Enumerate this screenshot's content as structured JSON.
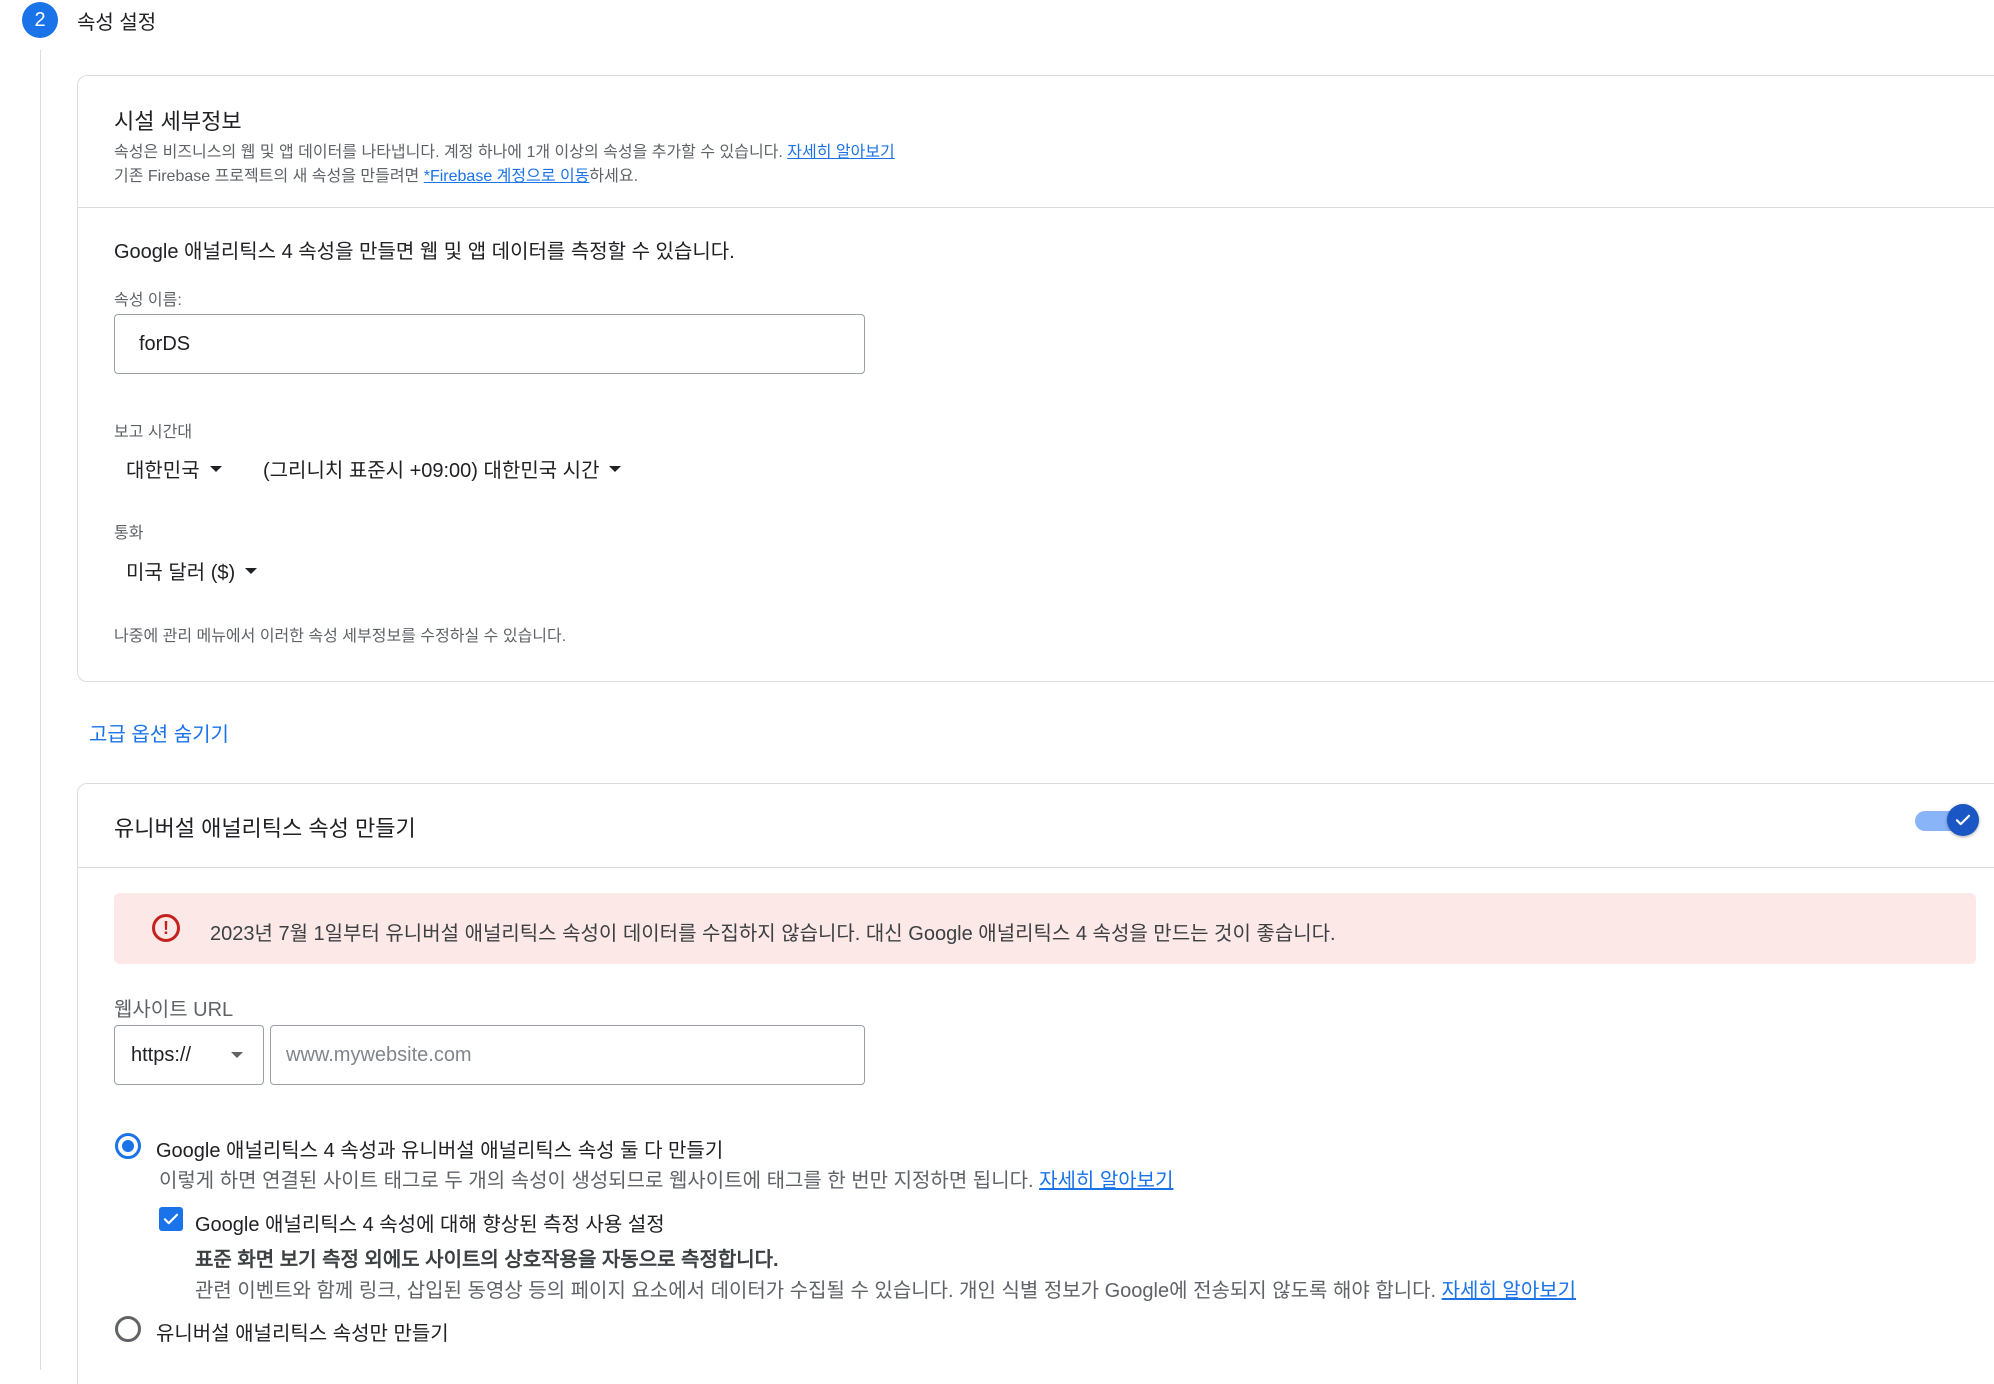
{
  "step": {
    "number": "2",
    "title": "속성 설정"
  },
  "details": {
    "title": "시설 세부정보",
    "desc1": "속성은 비즈니스의 웹 및 앱 데이터를 나타냅니다. 계정 하나에 1개 이상의 속성을 추가할 수 있습니다.",
    "desc1_link": "자세히 알아보기",
    "desc2_prefix": "기존 Firebase 프로젝트의 새 속성을 만들려면 ",
    "desc2_link": "*Firebase 계정으로 이동",
    "desc2_suffix": "하세요.",
    "ga4_intro": "Google 애널리틱스 4 속성을 만들면 웹 및 앱 데이터를 측정할 수 있습니다.",
    "property_name_label": "속성 이름:",
    "property_name_value": "forDS",
    "timezone_label": "보고 시간대",
    "country_select": "대한민국",
    "timezone_select": "(그리니치 표준시 +09:00) 대한민국 시간",
    "currency_label": "통화",
    "currency_select": "미국 달러 ($)",
    "footer_note": "나중에 관리 메뉴에서 이러한 속성 세부정보를 수정하실 수 있습니다."
  },
  "advanced_toggle_link": "고급 옵션 숨기기",
  "ua": {
    "title": "유니버설 애널리틱스 속성 만들기",
    "toggle_on": true,
    "warning": "2023년 7월 1일부터 유니버설 애널리틱스 속성이 데이터를 수집하지 않습니다. 대신 Google 애널리틱스 4 속성을 만드는 것이 좋습니다.",
    "website_url_label": "웹사이트 URL",
    "protocol_select": "https://",
    "url_placeholder": "www.mywebsite.com",
    "option_both_label": "Google 애널리틱스 4 속성과 유니버설 애널리틱스 속성 둘 다 만들기",
    "option_both_desc": "이렇게 하면 연결된 사이트 태그로 두 개의 속성이 생성되므로 웹사이트에 태그를 한 번만 지정하면 됩니다.",
    "option_both_link": "자세히 알아보기",
    "enhanced_label": "Google 애널리틱스 4 속성에 대해 향상된 측정 사용 설정",
    "enhanced_bold": "표준 화면 보기 측정 외에도 사이트의 상호작용을 자동으로 측정합니다.",
    "enhanced_desc": "관련 이벤트와 함께 링크, 삽입된 동영상 등의 페이지 요소에서 데이터가 수집될 수 있습니다. 개인 식별 정보가 Google에 전송되지 않도록 해야 합니다.",
    "enhanced_link": "자세히 알아보기",
    "option_ua_only_label": "유니버설 애널리틱스 속성만 만들기"
  }
}
